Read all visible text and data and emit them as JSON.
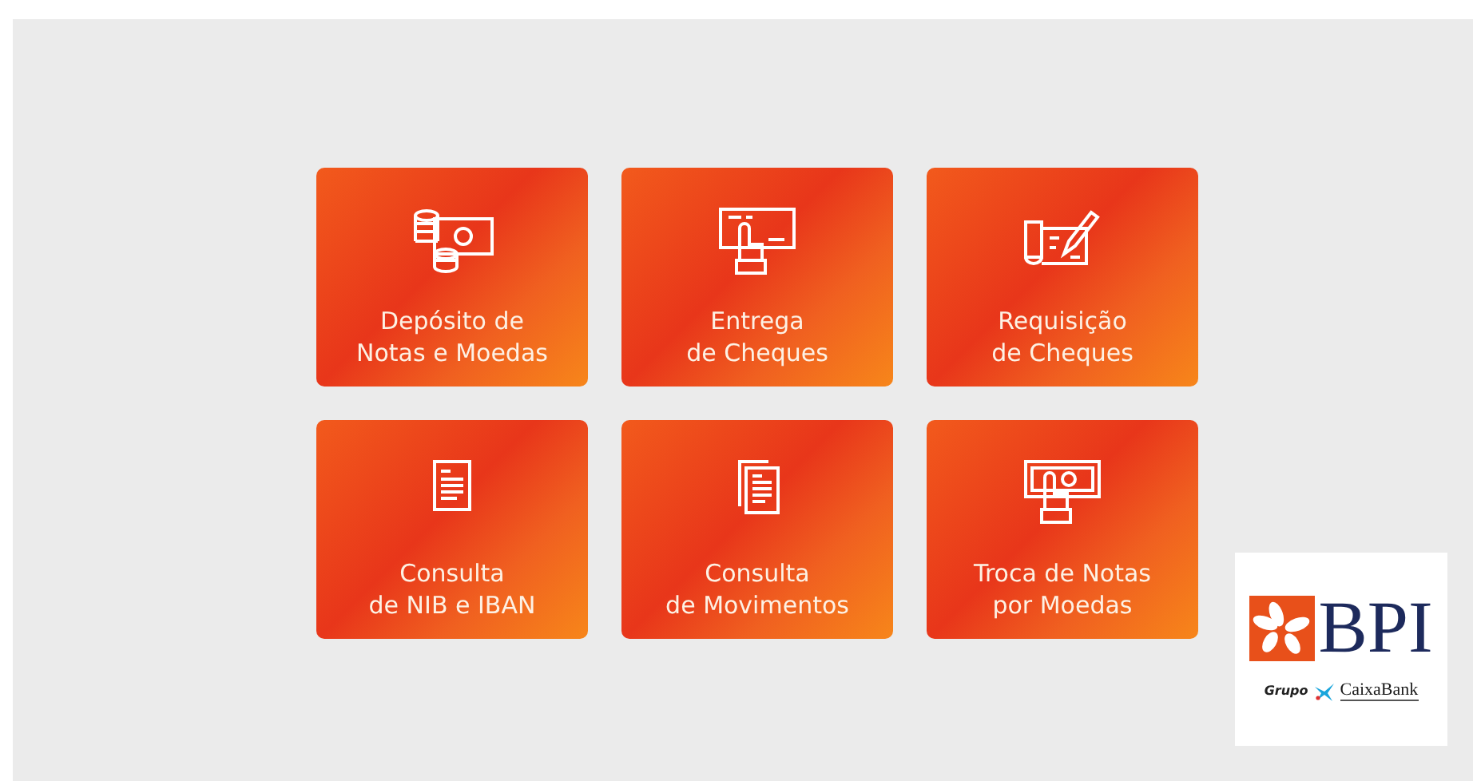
{
  "tiles": [
    {
      "lines": [
        "Depósito de",
        "Notas e Moedas"
      ]
    },
    {
      "lines": [
        "Entrega",
        "de Cheques"
      ]
    },
    {
      "lines": [
        "Requisição",
        "de Cheques"
      ]
    },
    {
      "lines": [
        "Consulta",
        "de NIB e IBAN"
      ]
    },
    {
      "lines": [
        "Consulta",
        "de Movimentos"
      ]
    },
    {
      "lines": [
        "Troca de Notas",
        "por Moedas"
      ]
    }
  ],
  "logo": {
    "brand": "BPI",
    "group": "Grupo",
    "partner": "CaixaBank"
  }
}
